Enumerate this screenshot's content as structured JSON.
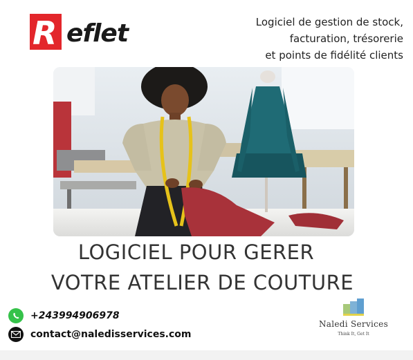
{
  "brand": {
    "name": "Reflet",
    "letter": "R",
    "word_rest": "eflet",
    "color": "#e3262b"
  },
  "tagline": [
    "Logiciel de gestion de stock,",
    "facturation, trésorerie",
    "et points de fidélité clients"
  ],
  "headline": [
    "LOGICIEL POUR GERER",
    "VOTRE ATELIER DE COUTURE"
  ],
  "contacts": {
    "phone": "+243994906978",
    "email": "contact@naledisservices.com",
    "phone_icon": "whatsapp-icon",
    "email_icon": "mail-icon"
  },
  "partner": {
    "name": "Naledi Services",
    "slogan": "Think It, Get It"
  },
  "colors": {
    "teal_dress": "#1f6b75",
    "tape": "#e6c21a",
    "leather": "#a8323a"
  }
}
